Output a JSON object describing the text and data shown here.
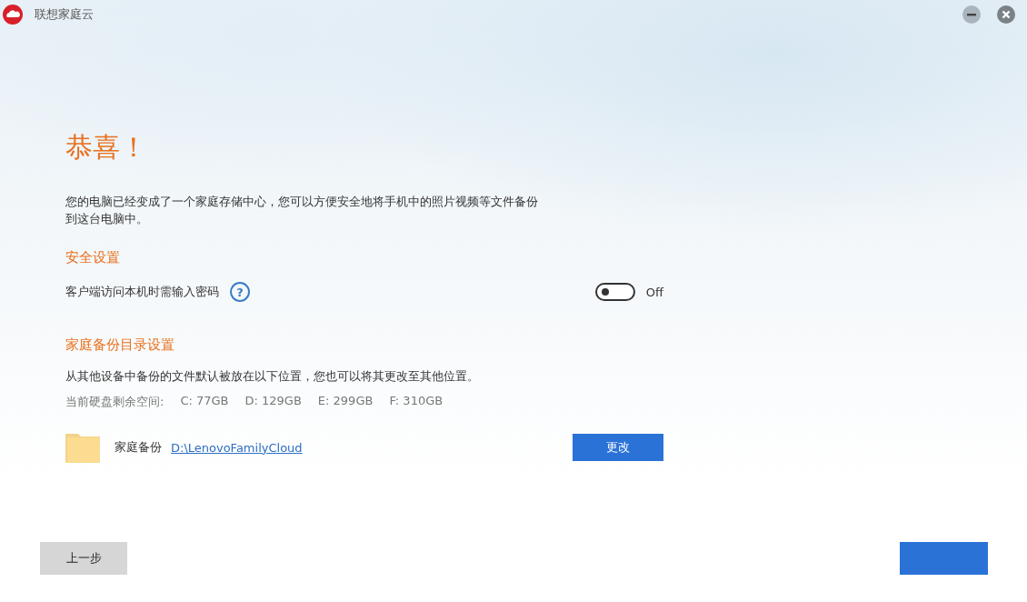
{
  "window": {
    "title": "联想家庭云"
  },
  "heading": "恭喜！",
  "intro": "您的电脑已经变成了一个家庭存储中心，您可以方便安全地将手机中的照片视频等文件备份到这台电脑中。",
  "security": {
    "title": "安全设置",
    "password_label": "客户端访问本机时需输入密码",
    "help": "?",
    "toggle": {
      "on": false,
      "label": "Off"
    }
  },
  "backup": {
    "title": "家庭备份目录设置",
    "description": "从其他设备中备份的文件默认被放在以下位置，您也可以将其更改至其他位置。",
    "space_label": "当前硬盘剩余空间:",
    "drives": [
      "C: 77GB",
      "D: 129GB",
      "E: 299GB",
      "F: 310GB"
    ],
    "folder_label": "家庭备份",
    "folder_path": "D:\\LenovoFamilyCloud",
    "change_button": "更改"
  },
  "back_button": "上一步"
}
